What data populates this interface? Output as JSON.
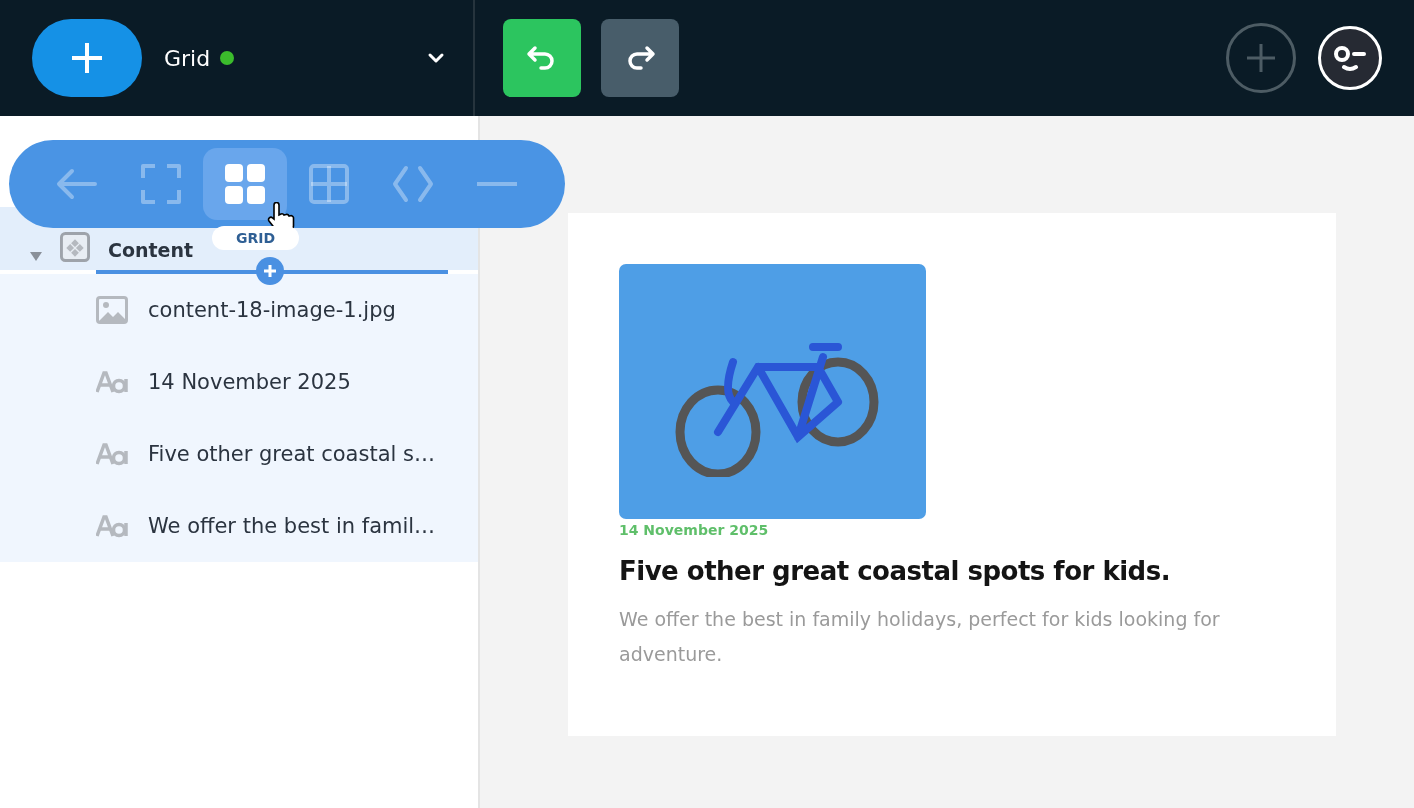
{
  "header": {
    "site": {
      "name": "Grid",
      "online": true
    },
    "history": [
      {
        "kind": "undo",
        "disabled": false
      },
      {
        "kind": "redo",
        "disabled": true
      }
    ]
  },
  "toolbar": {
    "items": [
      {
        "kind": "back",
        "selected": false
      },
      {
        "kind": "frame",
        "selected": false
      },
      {
        "kind": "grid",
        "selected": true
      },
      {
        "kind": "table",
        "selected": false
      },
      {
        "kind": "code",
        "selected": false
      },
      {
        "kind": "minus",
        "selected": false
      }
    ],
    "tooltip": "GRID"
  },
  "tree": [
    {
      "label": "Content",
      "kind": "block",
      "expanded": true,
      "children": [
        {
          "label": "content-18-image-1.jpg",
          "kind": "image"
        },
        {
          "label": "14 November 2025",
          "kind": "text"
        },
        {
          "label": "Five other great coastal s…",
          "kind": "text"
        },
        {
          "label": "We offer the best in famil…",
          "kind": "text"
        }
      ]
    }
  ],
  "card": {
    "date": "14 November 2025",
    "title": "Five other great coastal spots for kids.",
    "description": "We offer the best in family holidays, perfect for kids looking for adventure."
  }
}
